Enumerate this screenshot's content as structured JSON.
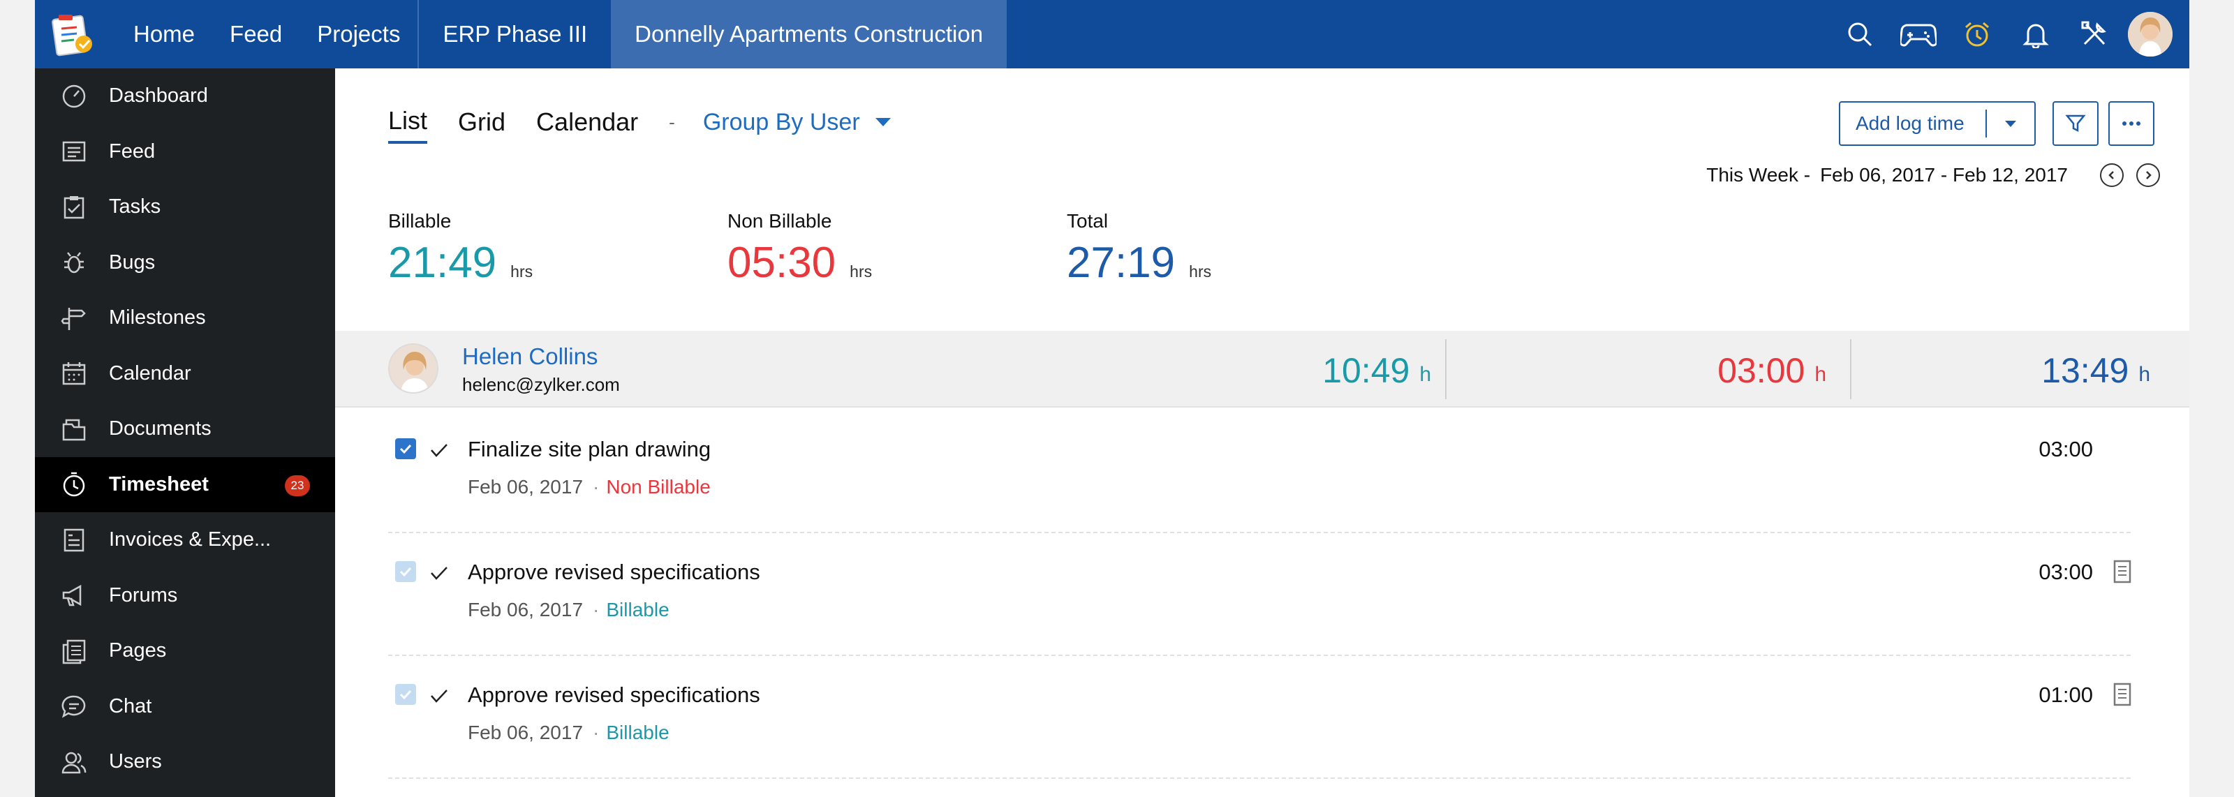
{
  "topnav": {
    "items": [
      "Home",
      "Feed",
      "Projects",
      "ERP Phase III",
      "Donnelly Apartments Construction"
    ]
  },
  "sidebar": {
    "items": [
      {
        "label": "Dashboard",
        "icon": "dashboard-icon"
      },
      {
        "label": "Feed",
        "icon": "feed-icon"
      },
      {
        "label": "Tasks",
        "icon": "tasks-icon"
      },
      {
        "label": "Bugs",
        "icon": "bug-icon"
      },
      {
        "label": "Milestones",
        "icon": "milestone-icon"
      },
      {
        "label": "Calendar",
        "icon": "calendar-icon"
      },
      {
        "label": "Documents",
        "icon": "documents-icon"
      },
      {
        "label": "Timesheet",
        "icon": "timer-icon",
        "badge": "23",
        "active": true
      },
      {
        "label": "Invoices & Expe...",
        "icon": "invoice-icon"
      },
      {
        "label": "Forums",
        "icon": "megaphone-icon"
      },
      {
        "label": "Pages",
        "icon": "pages-icon"
      },
      {
        "label": "Chat",
        "icon": "chat-icon"
      },
      {
        "label": "Users",
        "icon": "users-icon"
      }
    ]
  },
  "toolbar": {
    "views": [
      "List",
      "Grid",
      "Calendar"
    ],
    "separator": "-",
    "group_by": "Group By User",
    "add_log_time": "Add log time"
  },
  "week": {
    "label": "This Week -",
    "range": "Feb 06, 2017 - Feb 12, 2017"
  },
  "summary": {
    "billable": {
      "label": "Billable",
      "value": "21:49",
      "unit": "hrs"
    },
    "non_billable": {
      "label": "Non Billable",
      "value": "05:30",
      "unit": "hrs"
    },
    "total": {
      "label": "Total",
      "value": "27:19",
      "unit": "hrs"
    }
  },
  "user": {
    "name": "Helen Collins",
    "email": "helenc@zylker.com",
    "billable": "10:49",
    "non_billable": "03:00",
    "total": "13:49",
    "unit": "h"
  },
  "entries": [
    {
      "title": "Finalize site plan drawing",
      "date": "Feb 06, 2017",
      "dot": "·",
      "status": "Non Billable",
      "time": "03:00"
    },
    {
      "title": "Approve revised specifications",
      "date": "Feb 06, 2017",
      "dot": "·",
      "status": "Billable",
      "time": "03:00"
    },
    {
      "title": "Approve revised specifications",
      "date": "Feb 06, 2017",
      "dot": "·",
      "status": "Billable",
      "time": "01:00"
    }
  ],
  "colors": {
    "topbar": "#0f4b99",
    "billable": "#1a9aa8",
    "non_billable": "#e8383d",
    "total": "#1d5ba8",
    "link": "#1e6cc2"
  }
}
